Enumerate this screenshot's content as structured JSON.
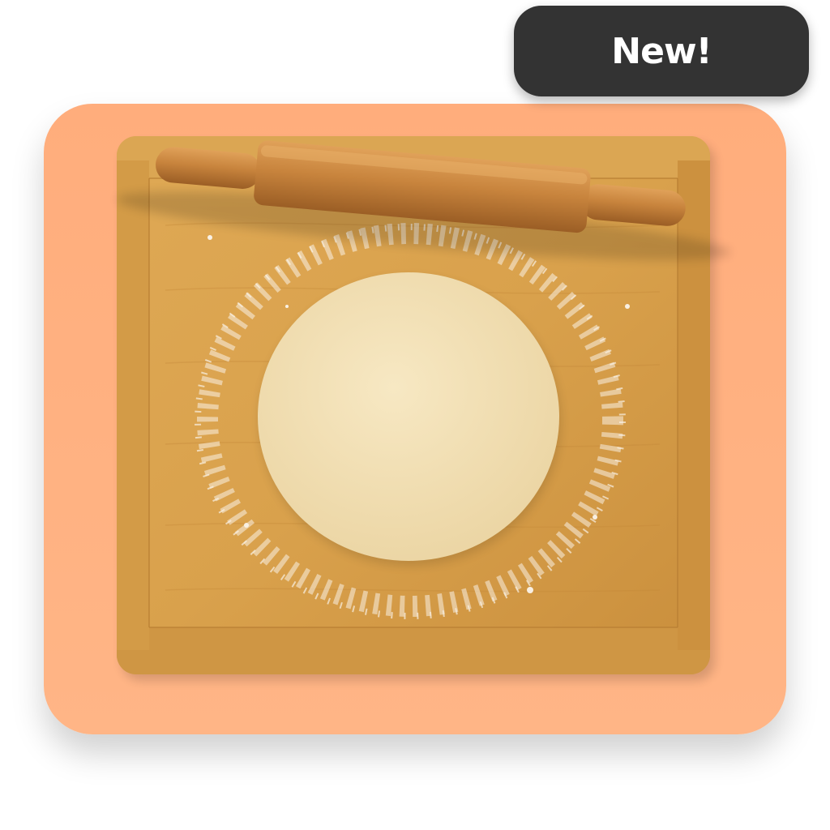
{
  "badge": {
    "label": "New!",
    "background": "#333333",
    "text_color": "#ffffff"
  },
  "icon": {
    "semantic_name": "rolling-pin-dough-icon",
    "tile_color": "#ffb182",
    "board_color": "#d9a24f",
    "board_edge_color": "#c88a3b",
    "pin_color": "#c27a36",
    "dough_color": "#f3e0b2",
    "flour_color": "#ffffff"
  }
}
